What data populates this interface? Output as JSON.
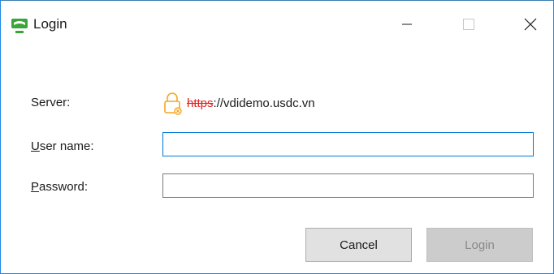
{
  "window": {
    "title": "Login",
    "controls": {
      "minimize": "minimize-icon",
      "maximize": "maximize-icon",
      "close": "close-icon"
    }
  },
  "form": {
    "server": {
      "label": "Server:",
      "scheme": "https",
      "rest": "://vdidemo.usdc.vn"
    },
    "username": {
      "label_access_key": "U",
      "label_rest": "ser name:",
      "value": ""
    },
    "password": {
      "label_access_key": "P",
      "label_rest": "assword:",
      "value": ""
    }
  },
  "buttons": {
    "cancel": "Cancel",
    "login": "Login"
  },
  "colors": {
    "accent": "#0078d7",
    "app_icon_green": "#3aa53a",
    "lock_orange": "#f5a623",
    "insecure_red": "#e02020"
  }
}
